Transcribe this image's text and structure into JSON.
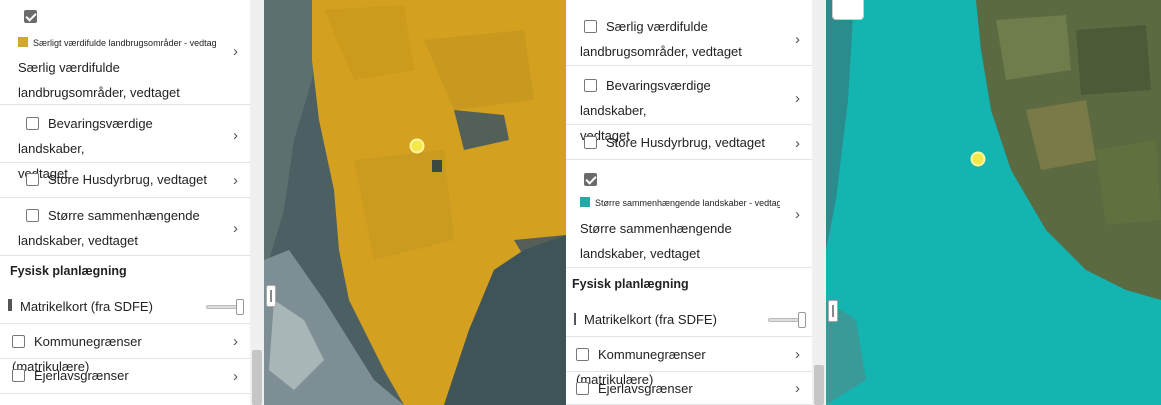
{
  "left_panel": {
    "active_layer": {
      "legend": "Særligt værdifulde landbrugsområder - vedtaget",
      "legend_color": "#d4a92a",
      "name_line1": "Særlig værdifulde",
      "name_line2": "landbrugsområder, vedtaget"
    },
    "layer_bevaring_line1": "Bevaringsværdige landskaber,",
    "layer_bevaring_line2": "vedtaget",
    "layer_husdyr": "Store Husdyrbrug, vedtaget",
    "layer_stoerre_line1": "Større sammenhængende",
    "layer_stoerre_line2": "landskaber, vedtaget",
    "section": "Fysisk planlægning",
    "matrikel": "Matrikelkort (fra SDFE)",
    "kommune": "Kommunegrænser (matrikulære)",
    "ejerlav": "Ejerlavsgrænser"
  },
  "right_panel": {
    "layer_saerlig_line1": "Særlig værdifulde",
    "layer_saerlig_line2": "landbrugsområder, vedtaget",
    "layer_bevaring_line1": "Bevaringsværdige landskaber,",
    "layer_bevaring_line2": "vedtaget",
    "layer_husdyr": "Store Husdyrbrug, vedtaget",
    "active_layer": {
      "legend": "Større sammenhængende landskaber - vedtaget",
      "legend_color": "#2aa6a6",
      "name_line1": "Større sammenhængende",
      "name_line2": "landskaber, vedtaget"
    },
    "section": "Fysisk planlægning",
    "matrikel": "Matrikelkort (fra SDFE)",
    "kommune": "Kommunegrænser (matrikulære)",
    "ejerlav": "Ejerlavsgrænser"
  },
  "icons": {
    "chevron": "›",
    "checkbox_checked": "check-icon",
    "map_marker": "marker-icon"
  },
  "colors": {
    "left_overlay": "#d4a020",
    "right_overlay": "#14b4b0",
    "marker": "#f4e84a"
  }
}
